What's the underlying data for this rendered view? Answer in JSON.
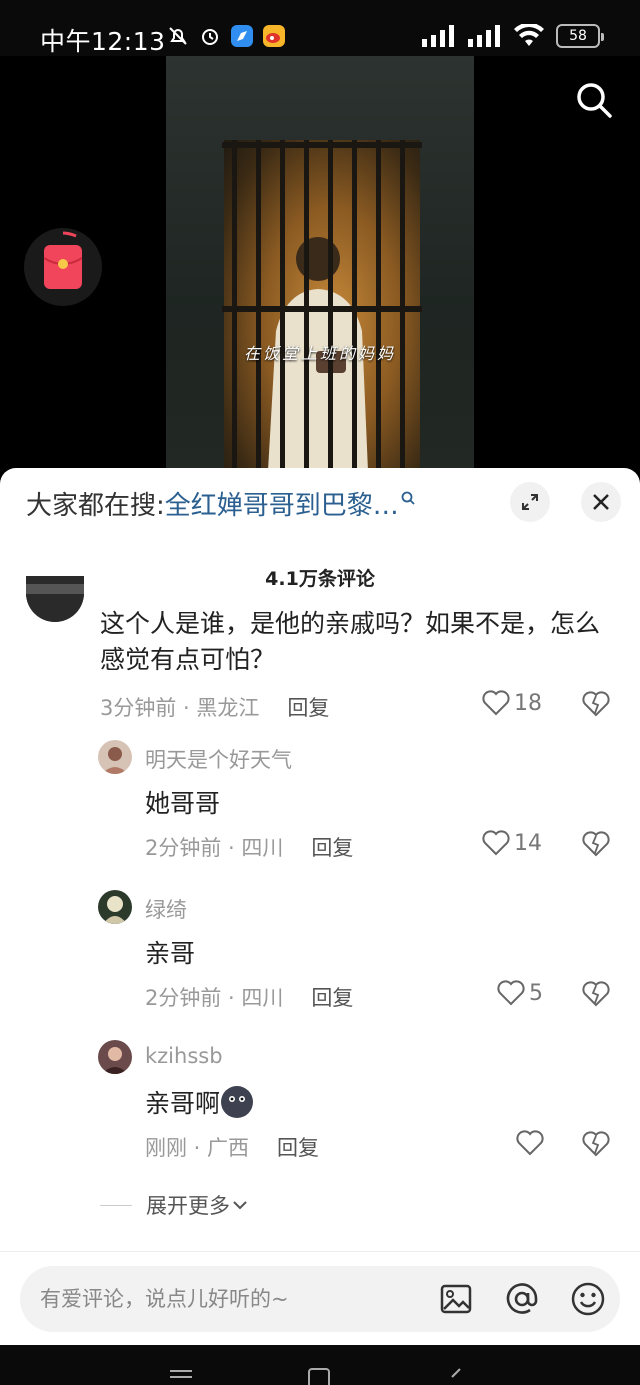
{
  "status_bar": {
    "time": "中午12:13",
    "battery": "58"
  },
  "video": {
    "subtitle": "在饭堂上班的妈妈"
  },
  "sheet": {
    "hot_search_label": "大家都在搜:",
    "hot_search_term": "全红婵哥哥到巴黎…",
    "comment_count": "4.1万条评论"
  },
  "comments": {
    "main": {
      "text": "这个人是谁，是他的亲戚吗？如果不是，怎么感觉有点可怕？",
      "time_location": "3分钟前 · 黑龙江",
      "reply_label": "回复",
      "likes": "18"
    },
    "replies": [
      {
        "username": "明天是个好天气",
        "text": "她哥哥",
        "time_location": "2分钟前 · 四川",
        "reply_label": "回复",
        "likes": "14"
      },
      {
        "username": "绿绮",
        "text": "亲哥",
        "time_location": "2分钟前 · 四川",
        "reply_label": "回复",
        "likes": "5"
      },
      {
        "username": "kzihssb",
        "text": "亲哥啊",
        "time_location": "刚刚 · 广西",
        "reply_label": "回复",
        "likes": ""
      }
    ],
    "expand_more": "展开更多"
  },
  "input": {
    "placeholder": "有爱评论，说点儿好听的~"
  },
  "colors": {
    "accent_link": "#2a5f8f",
    "red_packet": "#f0455a"
  }
}
